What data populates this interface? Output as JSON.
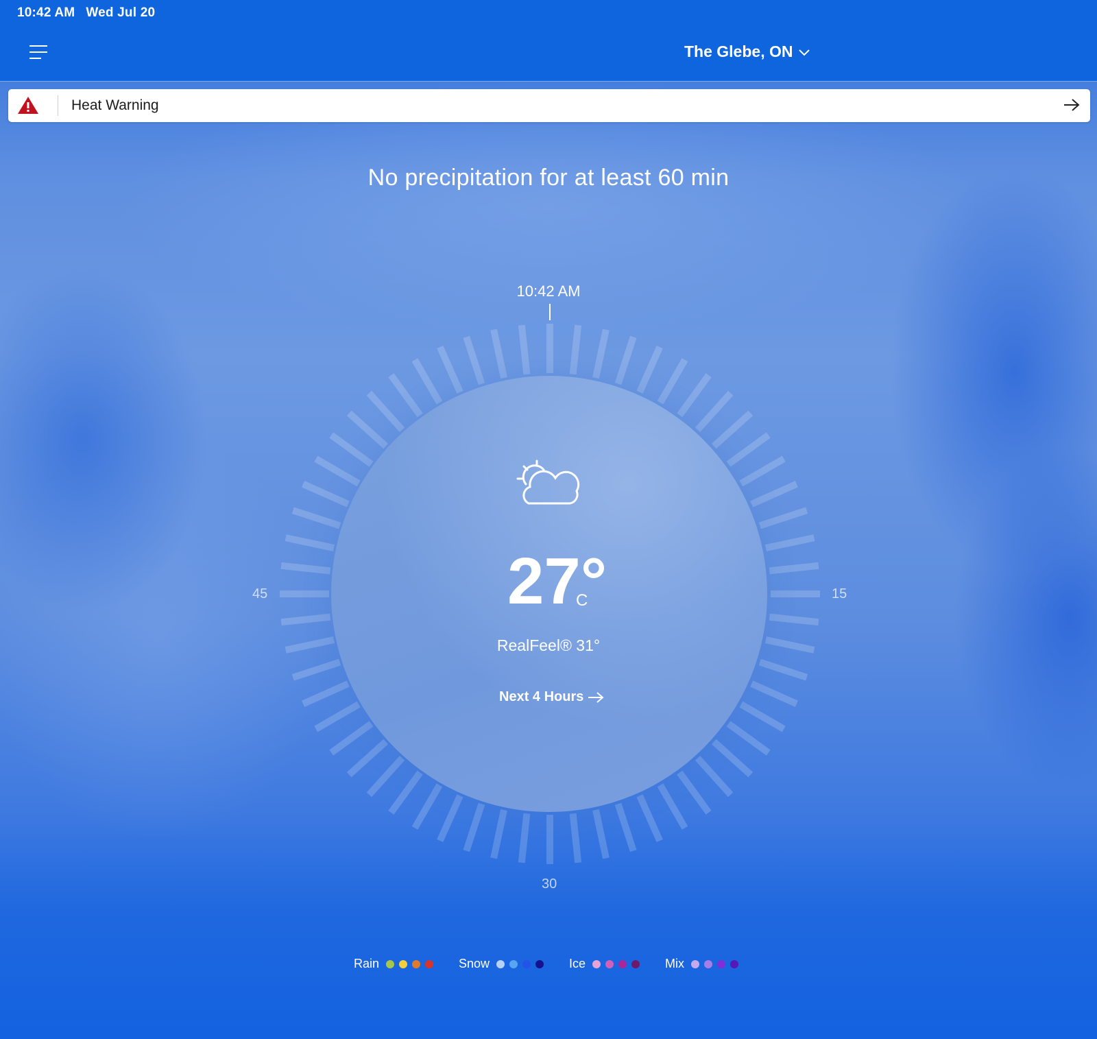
{
  "status_bar": {
    "time": "10:42 AM",
    "date": "Wed Jul 20"
  },
  "header": {
    "location": "The Glebe, ON"
  },
  "alert": {
    "label": "Heat Warning"
  },
  "minutecast": {
    "headline": "No precipitation for at least 60 min",
    "current_time": "10:42 AM",
    "dial_labels": {
      "right": "15",
      "bottom": "30",
      "left": "45"
    }
  },
  "current": {
    "temperature": "27°",
    "unit": "C",
    "realfeel": "RealFeel® 31°",
    "next_hours_label": "Next 4 Hours",
    "icon": "partly-cloudy-icon"
  },
  "legend": [
    {
      "label": "Rain",
      "colors": [
        "#a7c74a",
        "#f2cf3c",
        "#e07a2c",
        "#d8352a"
      ]
    },
    {
      "label": "Snow",
      "colors": [
        "#b6d2f8",
        "#5aa5f2",
        "#2453e8",
        "#14128f"
      ]
    },
    {
      "label": "Ice",
      "colors": [
        "#e6a3d6",
        "#cf62b8",
        "#a8279a",
        "#6e1a6a"
      ]
    },
    {
      "label": "Mix",
      "colors": [
        "#c7a9ee",
        "#a77de8",
        "#7e2fd8",
        "#5419b7"
      ]
    }
  ]
}
